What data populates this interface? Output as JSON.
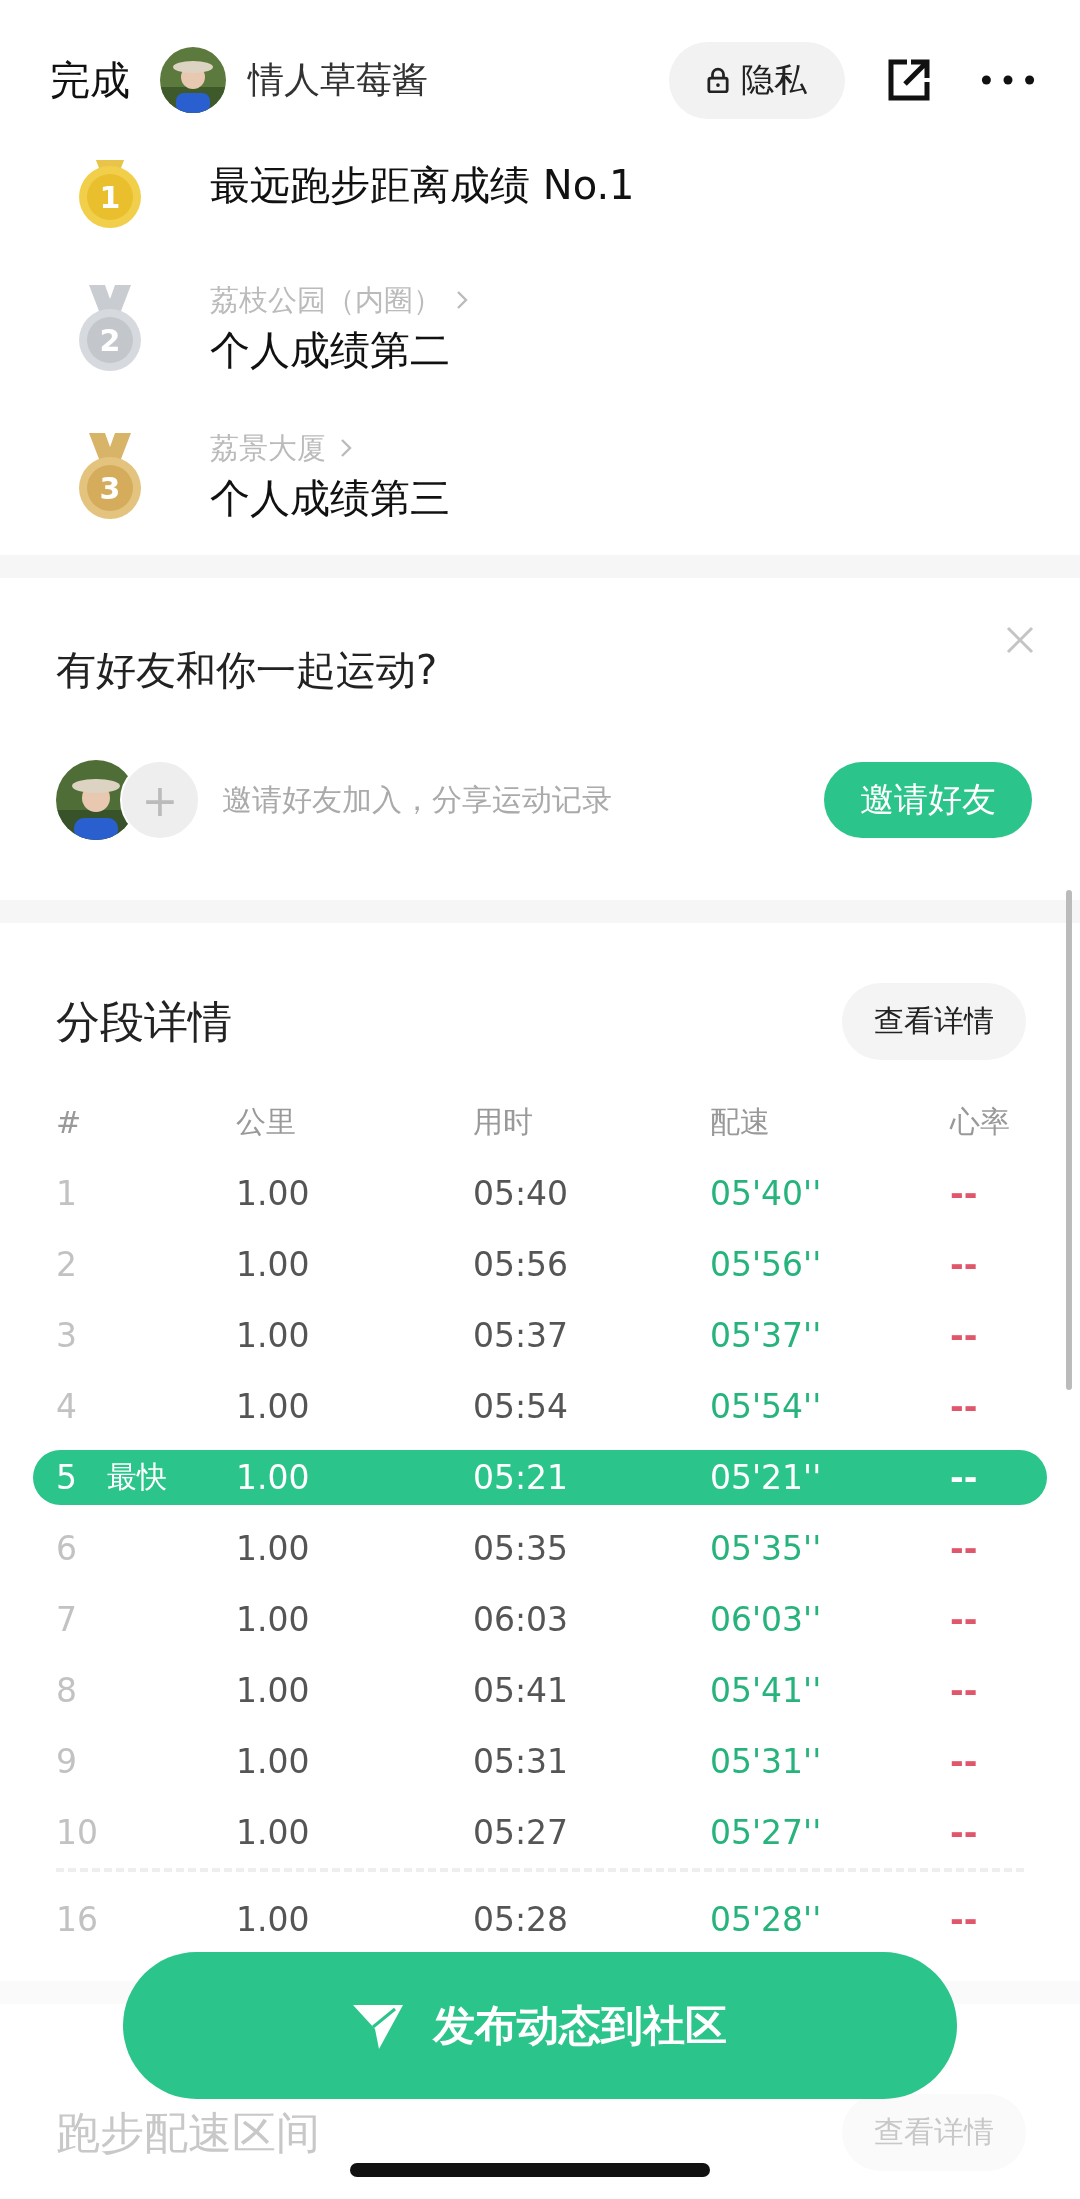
{
  "header": {
    "done": "完成",
    "username": "情人草莓酱",
    "privacy": "隐私"
  },
  "records": [
    {
      "kind": "gold",
      "rank": "1",
      "title": "最远跑步距离成绩 No.1"
    },
    {
      "kind": "silver",
      "rank": "2",
      "place": "荔枝公园（内圈）",
      "title": "个人成绩第二"
    },
    {
      "kind": "bronze",
      "rank": "3",
      "place": "荔景大厦",
      "title": "个人成绩第三"
    }
  ],
  "invite": {
    "title": "有好友和你一起运动?",
    "plus": "+",
    "hint": "邀请好友加入，分享运动记录",
    "button": "邀请好友"
  },
  "splits": {
    "title": "分段详情",
    "details_button": "查看详情",
    "columns": [
      "#",
      "公里",
      "用时",
      "配速",
      "心率"
    ],
    "rows": [
      {
        "index": "1",
        "km": "1.00",
        "time": "05:40",
        "pace": "05'40''",
        "heart": "--",
        "fastest": false
      },
      {
        "index": "2",
        "km": "1.00",
        "time": "05:56",
        "pace": "05'56''",
        "heart": "--",
        "fastest": false
      },
      {
        "index": "3",
        "km": "1.00",
        "time": "05:37",
        "pace": "05'37''",
        "heart": "--",
        "fastest": false
      },
      {
        "index": "4",
        "km": "1.00",
        "time": "05:54",
        "pace": "05'54''",
        "heart": "--",
        "fastest": false
      },
      {
        "index": "5",
        "tag": "最快",
        "km": "1.00",
        "time": "05:21",
        "pace": "05'21''",
        "heart": "--",
        "fastest": true
      },
      {
        "index": "6",
        "km": "1.00",
        "time": "05:35",
        "pace": "05'35''",
        "heart": "--",
        "fastest": false
      },
      {
        "index": "7",
        "km": "1.00",
        "time": "06:03",
        "pace": "06'03''",
        "heart": "--",
        "fastest": false
      },
      {
        "index": "8",
        "km": "1.00",
        "time": "05:41",
        "pace": "05'41''",
        "heart": "--",
        "fastest": false
      },
      {
        "index": "9",
        "km": "1.00",
        "time": "05:31",
        "pace": "05'31''",
        "heart": "--",
        "fastest": false
      },
      {
        "index": "10",
        "km": "1.00",
        "time": "05:27",
        "pace": "05'27''",
        "heart": "--",
        "fastest": false
      }
    ],
    "tail_rows": [
      {
        "index": "16",
        "km": "1.00",
        "time": "05:28",
        "pace": "05'28''",
        "heart": "--",
        "fastest": false
      }
    ]
  },
  "pace_zones": {
    "title": "跑步配速区间",
    "details_button": "查看详情"
  },
  "publish_button": "发布动态到社区"
}
